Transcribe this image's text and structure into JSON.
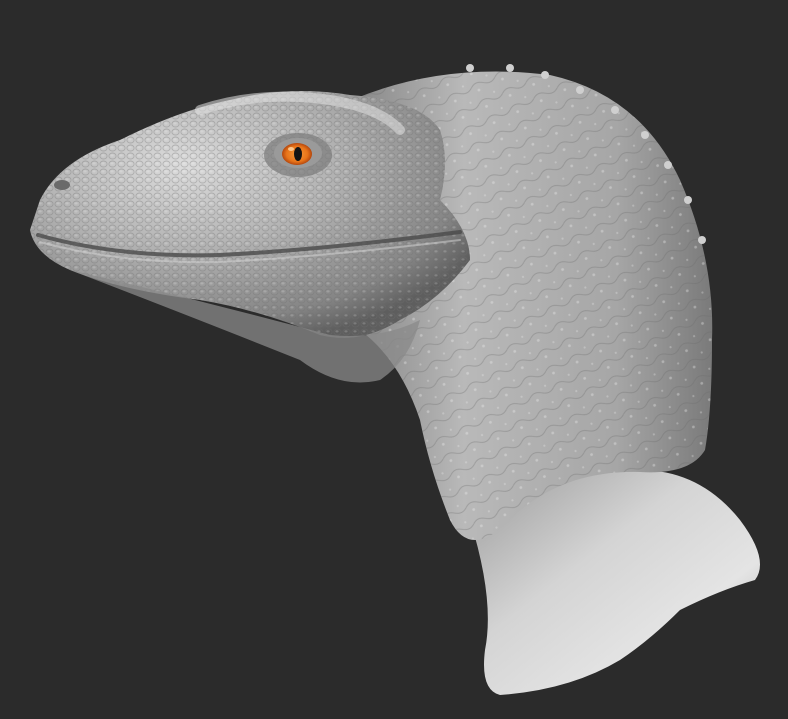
{
  "viewport": {
    "background_color": "#2b2b2b",
    "subject": "raptor-head-sculpt"
  },
  "sculpt": {
    "material": "matcap-clay",
    "base_color": "#b9b9b9",
    "highlight_color": "#e6e6e6",
    "shadow_color": "#5a5a5a",
    "neck_base_color": "#c9c9c9"
  },
  "eye": {
    "iris_color": "#e8741a",
    "iris_outer_color": "#b4470d",
    "pupil_color": "#141414"
  }
}
